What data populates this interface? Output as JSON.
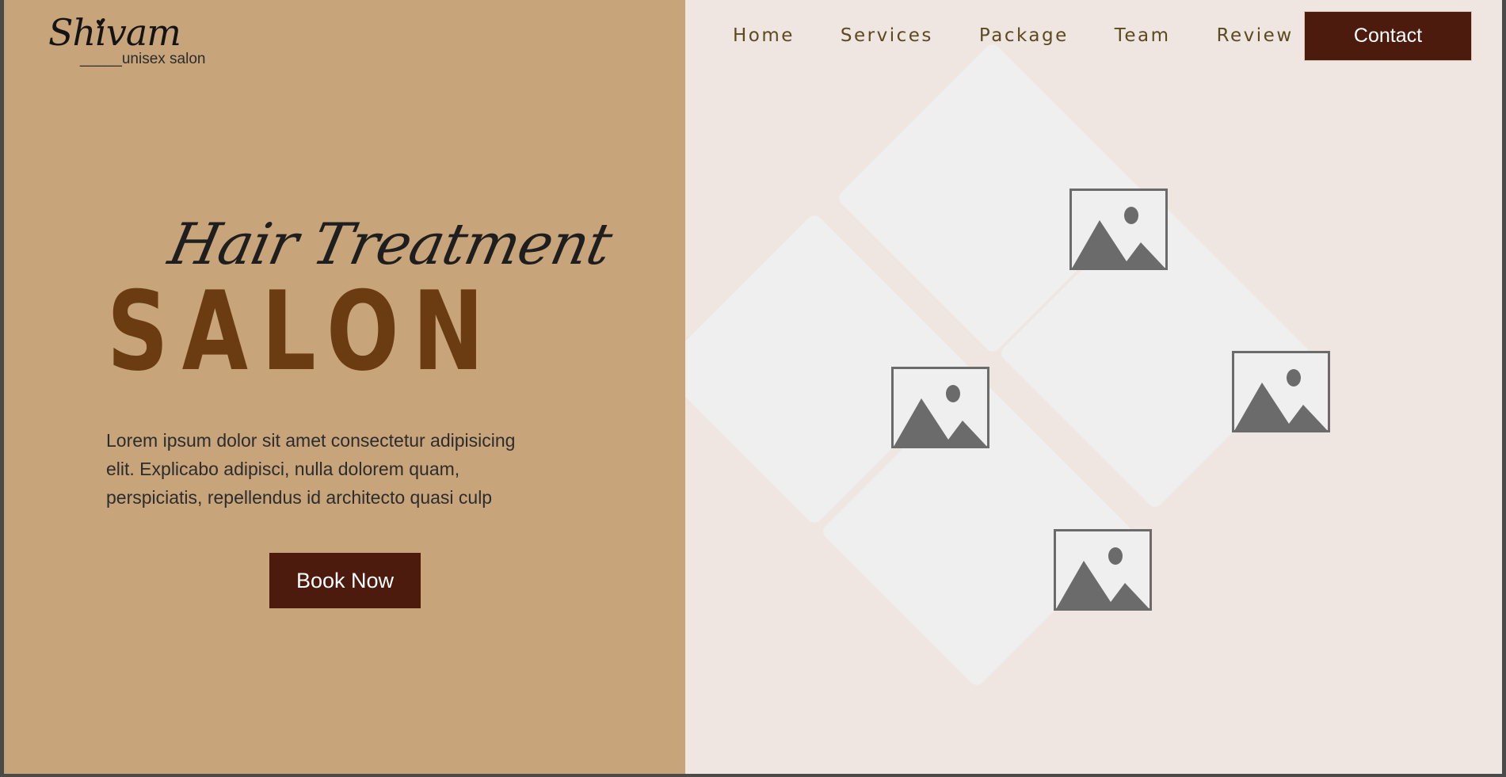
{
  "brand": {
    "name": "Shivam",
    "tagline": "_____unisex salon"
  },
  "nav": {
    "items": [
      {
        "label": "Home"
      },
      {
        "label": "Services"
      },
      {
        "label": "Package"
      },
      {
        "label": "Team"
      },
      {
        "label": "Review"
      }
    ],
    "contact_label": "Contact"
  },
  "hero": {
    "script_heading": "Hair Treatment",
    "title": "SALON",
    "description": "Lorem ipsum dolor sit amet consectetur adipisicing elit. Explicabo adipisci, nulla dolorem quam, perspiciatis, repellendus id architecto quasi culp",
    "cta_label": "Book Now"
  },
  "gallery": {
    "images": [
      {
        "icon": "image-placeholder-icon"
      },
      {
        "icon": "image-placeholder-icon"
      },
      {
        "icon": "image-placeholder-icon"
      },
      {
        "icon": "image-placeholder-icon"
      }
    ]
  },
  "colors": {
    "left_bg": "#c8a47b",
    "right_bg": "#efe5e1",
    "accent": "#4c1b0e",
    "title": "#6b3c12",
    "nav_text": "#5b4a1f"
  }
}
